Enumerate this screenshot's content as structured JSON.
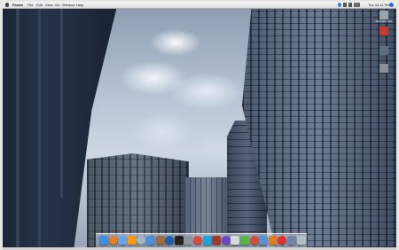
{
  "menubar": {
    "app_name": "Finder",
    "items": [
      "File",
      "Edit",
      "View",
      "Go",
      "Window",
      "Help"
    ],
    "clock": "Tue 12:11 PM"
  },
  "desktop": {
    "icons": [
      {
        "label": "Macintosh HD",
        "color": "#9aa3ae"
      },
      {
        "label": "",
        "color": "#c43b2c"
      },
      {
        "label": "",
        "color": "#5c6e86"
      },
      {
        "label": "",
        "color": "#8a8f96"
      }
    ]
  },
  "dock": {
    "apps": [
      {
        "name": "finder-icon",
        "color": "#3d8ee0"
      },
      {
        "name": "firefox-icon",
        "color": "#e8801f"
      },
      {
        "name": "itunes-icon",
        "color": "#6aa4e8"
      },
      {
        "name": "vlc-icon",
        "color": "#f29b1a"
      },
      {
        "name": "mail-icon",
        "color": "#9fb6cf"
      },
      {
        "name": "safari-icon",
        "color": "#4b8fd9"
      },
      {
        "name": "address-book-icon",
        "color": "#a26b3e"
      },
      {
        "name": "photoshop-icon",
        "color": "#1f5ea8"
      },
      {
        "name": "terminal-icon",
        "color": "#222222"
      },
      {
        "name": "system-preferences-icon",
        "color": "#8f949b"
      },
      {
        "name": "chrome-icon",
        "color": "#e0463b"
      },
      {
        "name": "skype-icon",
        "color": "#1fa3e0"
      },
      {
        "name": "photo-booth-icon",
        "color": "#a33a2e"
      },
      {
        "name": "ichat-icon",
        "color": "#6b45c4"
      },
      {
        "name": "preview-icon",
        "color": "#d9d9d9"
      },
      {
        "name": "adium-icon",
        "color": "#53b544"
      },
      {
        "name": "ical-icon",
        "color": "#d84a3a"
      },
      {
        "name": "iphoto-icon",
        "color": "#5a8fd0"
      },
      {
        "name": "garageband-icon",
        "color": "#e07a25"
      },
      {
        "name": "transmission-icon",
        "color": "#d33"
      },
      {
        "name": "downloads-icon",
        "color": "#6f86a6"
      },
      {
        "name": "trash-icon",
        "color": "#b9bec5"
      }
    ]
  }
}
